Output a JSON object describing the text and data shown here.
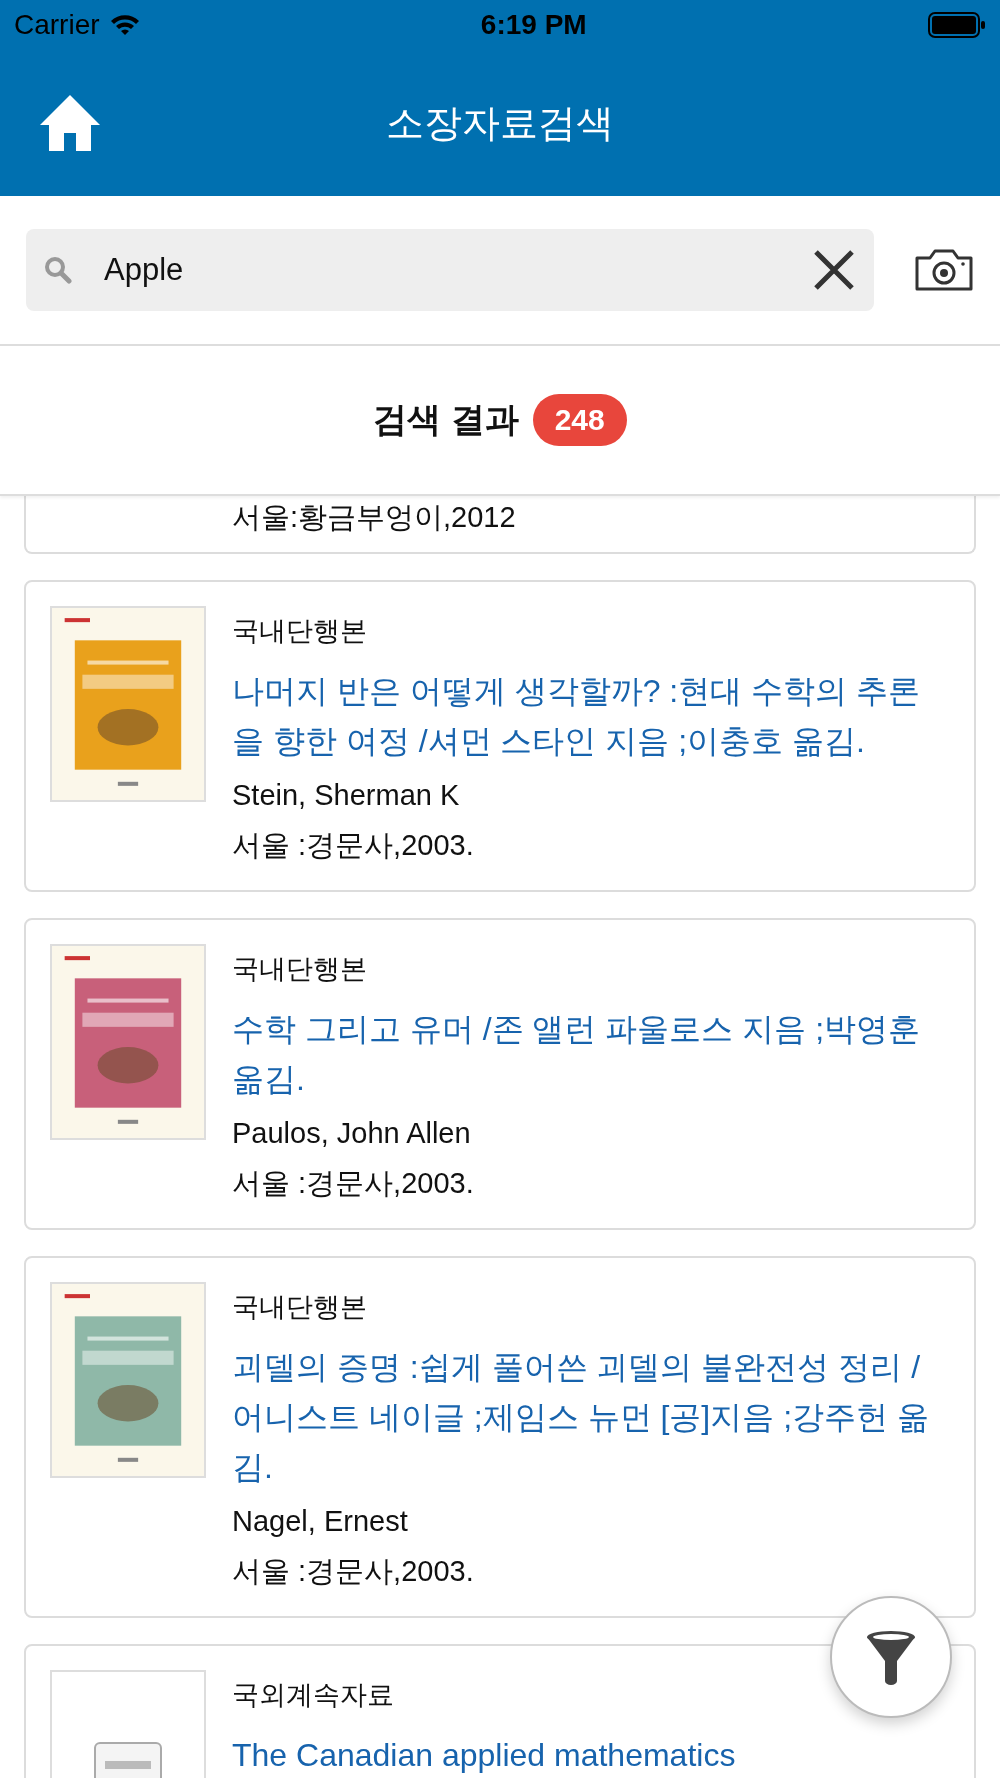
{
  "status_bar": {
    "carrier": "Carrier",
    "time": "6:19 PM"
  },
  "nav_bar": {
    "title": "소장자료검색"
  },
  "search": {
    "value": "Apple"
  },
  "results_header": {
    "label": "검색 결과",
    "count": "248"
  },
  "partial_result": {
    "imprint": "서울:황금부엉이,2012"
  },
  "results": [
    {
      "kind": "picture",
      "type": "국내단행본",
      "title": "나머지 반은 어떻게 생각할까? :현대 수학의 추론을 향한 여정 /셔먼 스타인 지음 ;이충호 옮김.",
      "author": "Stein, Sherman K",
      "imprint": "서울 :경문사,2003."
    },
    {
      "kind": "picture",
      "type": "국내단행본",
      "title": "수학 그리고 유머 /존 앨런 파울로스 지음 ;박영훈 옮김.",
      "author": "Paulos, John Allen",
      "imprint": "서울 :경문사,2003."
    },
    {
      "kind": "picture",
      "type": "국내단행본",
      "title": "괴델의 증명 :쉽게 풀어쓴 괴델의 불완전성 정리 /어니스트 네이글 ;제임스 뉴먼 [공]지음 ;강주헌 옮김.",
      "author": "Nagel, Ernest",
      "imprint": "서울 :경문사,2003."
    },
    {
      "kind": "placeholder",
      "type": "국외계속자료",
      "title": "The Canadian applied mathematics"
    }
  ]
}
